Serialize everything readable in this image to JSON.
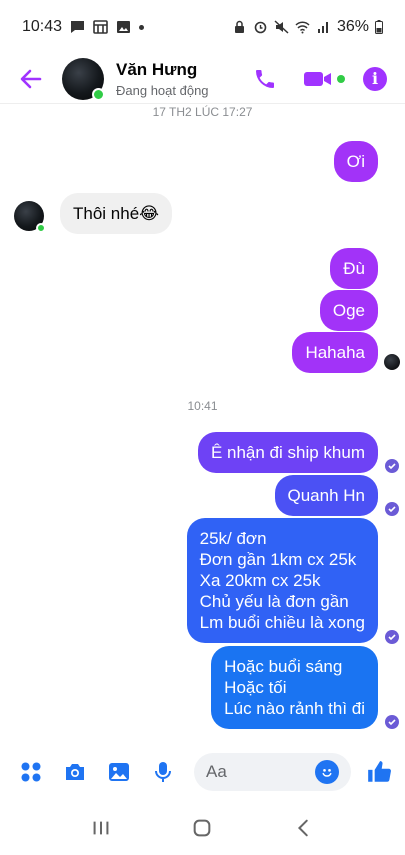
{
  "status_bar": {
    "time": "10:43",
    "battery": "36%"
  },
  "header": {
    "name": "Văn Hưng",
    "status": "Đang hoạt động"
  },
  "chat": {
    "timestamp_top": "17 TH2 LÚC 17:27",
    "timestamp_mid": "10:41",
    "messages": [
      {
        "direction": "sent",
        "text": "Ơi"
      },
      {
        "direction": "received",
        "text": "Thôi nhé😂"
      },
      {
        "direction": "sent",
        "text": "Đù"
      },
      {
        "direction": "sent",
        "text": "Oge"
      },
      {
        "direction": "sent",
        "text": "Hahaha"
      },
      {
        "direction": "sent",
        "text": "Ê nhận đi ship khum"
      },
      {
        "direction": "sent",
        "text": "Quanh Hn"
      },
      {
        "direction": "sent",
        "lines": [
          "25k/ đơn",
          "Đơn gần 1km cx 25k",
          "Xa 20km cx 25k",
          "Chủ yếu là đơn gần",
          "Lm buổi chiều là xong"
        ]
      },
      {
        "direction": "sent",
        "lines": [
          "Hoặc buổi sáng",
          "Hoặc tối",
          "Lúc nào rảnh thì đi"
        ]
      }
    ]
  },
  "composer": {
    "placeholder": "Aa"
  },
  "colors": {
    "accent": "#a033ff",
    "online": "#31cc46",
    "messenger_blue": "#1f74f2"
  }
}
